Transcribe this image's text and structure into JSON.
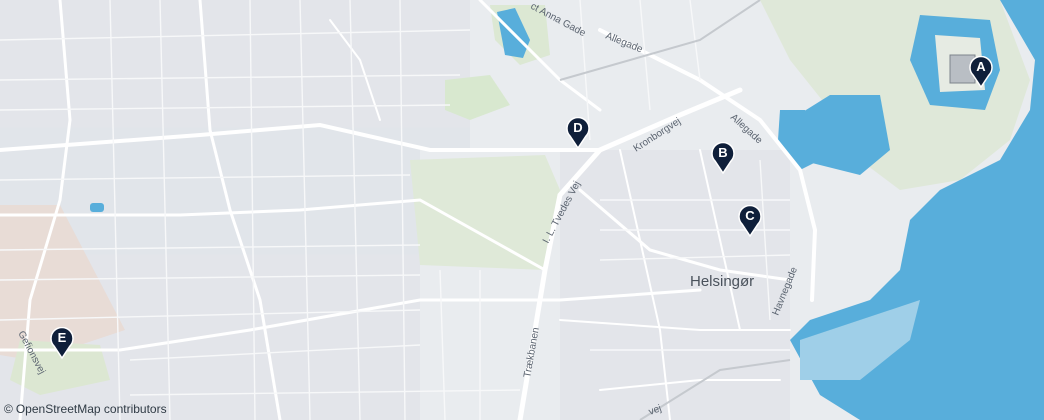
{
  "map": {
    "city_label": "Helsingør",
    "street_labels": {
      "prinsesse": "ct Anna Gade",
      "allegade_top": "Allegade",
      "allegade_right": "Allegade",
      "kronborgvej": "Kronborgvej",
      "tvedes": "I. L. Tvedes Vej",
      "traekbanen": "Trækbanen",
      "havnegade": "Havnegade",
      "gefionsvej": "Gefionsvej",
      "bottom_vej": "vej"
    },
    "markers": [
      {
        "letter": "A"
      },
      {
        "letter": "B"
      },
      {
        "letter": "C"
      },
      {
        "letter": "D"
      },
      {
        "letter": "E"
      }
    ],
    "attribution": {
      "symbol": "©",
      "text": "OpenStreetMap contributors"
    },
    "colors": {
      "water": "#58aedb",
      "land": "#e9ecef",
      "park": "#e1ecd7",
      "marker": "#0f1f3a",
      "roads": "#ffffff"
    }
  }
}
